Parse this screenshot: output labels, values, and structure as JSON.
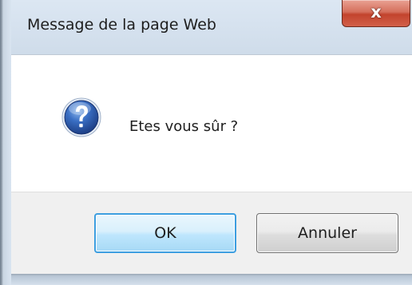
{
  "dialog": {
    "title": "Message de la page Web",
    "close_glyph": "x",
    "message": "Etes vous sûr ?",
    "icon": "question-icon",
    "buttons": {
      "ok_label": "OK",
      "cancel_label": "Annuler"
    }
  },
  "colors": {
    "close_button": "#c2432d",
    "icon_blue": "#2a5aa8",
    "default_button_border": "#3c9ee0"
  }
}
